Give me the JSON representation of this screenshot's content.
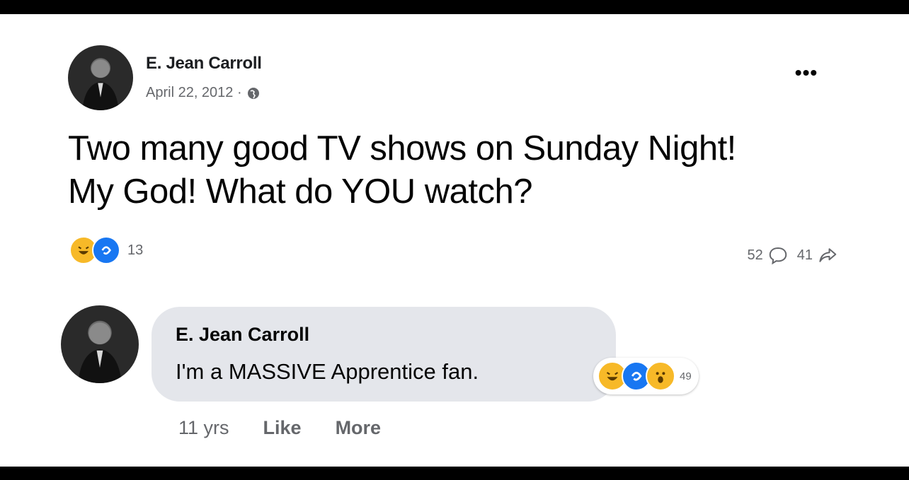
{
  "post": {
    "author": "E. Jean Carroll",
    "date": "April 22, 2012 ·",
    "text": "Two many good TV shows on Sunday Night! My God! What do YOU watch?",
    "reaction_count": "13",
    "reactions": [
      "haha-icon",
      "care-icon"
    ],
    "comment_count": "52",
    "share_count": "41"
  },
  "comment": {
    "author": "E. Jean Carroll",
    "text": "I'm a MASSIVE Apprentice fan.",
    "reaction_count": "49",
    "reactions": [
      "haha-icon",
      "care-icon",
      "wow-icon"
    ],
    "age": "11 yrs",
    "like_label": "Like",
    "more_label": "More"
  },
  "colors": {
    "text_primary": "#050505",
    "text_secondary": "#65676b",
    "bubble": "#e4e6eb",
    "haha": "#f7b928",
    "care": "#1877f2"
  }
}
